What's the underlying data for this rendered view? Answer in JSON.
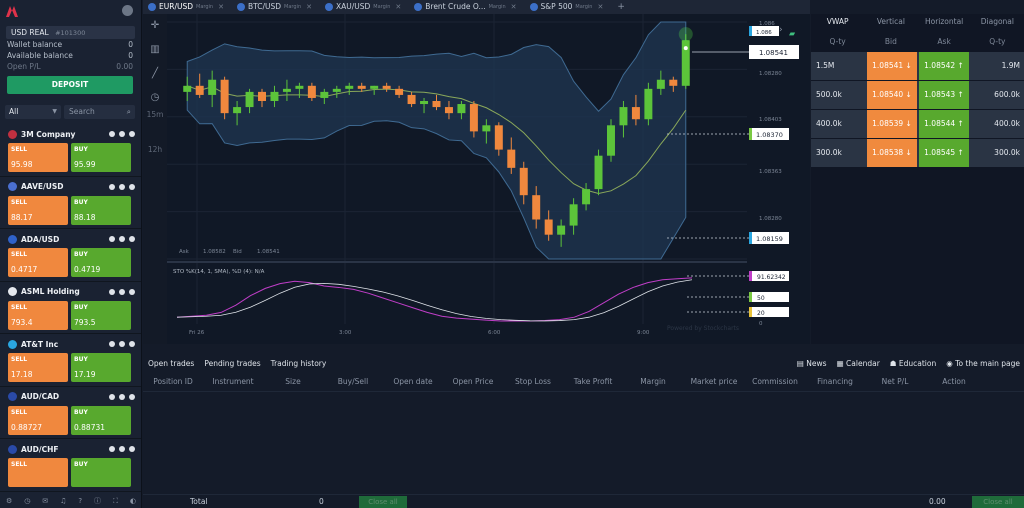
{
  "account": {
    "currency": "USD",
    "mode": "REAL",
    "id": "#101300",
    "wallet_label": "Wallet balance",
    "wallet_value": "0",
    "available_label": "Available balance",
    "available_value": "0",
    "pl_label": "Open P/L",
    "pl_value": "0.00",
    "deposit_label": "DEPOSIT"
  },
  "filter": {
    "selected": "All",
    "search_placeholder": "Search"
  },
  "instruments": [
    {
      "name": "3M Company",
      "sell_label": "SELL",
      "buy_label": "BUY",
      "sell": "95.98",
      "buy": "95.99",
      "flag_color": "#c03040"
    },
    {
      "name": "AAVE/USD",
      "sell_label": "SELL",
      "buy_label": "BUY",
      "sell": "88.17",
      "buy": "88.18",
      "flag_color": "#4a6fd0"
    },
    {
      "name": "ADA/USD",
      "sell_label": "SELL",
      "buy_label": "BUY",
      "sell": "0.4717",
      "buy": "0.4719",
      "flag_color": "#2f62c9"
    },
    {
      "name": "ASML Holding",
      "sell_label": "SELL",
      "buy_label": "BUY",
      "sell": "793.4",
      "buy": "793.5",
      "flag_color": "#e5e8ee"
    },
    {
      "name": "AT&T Inc",
      "sell_label": "SELL",
      "buy_label": "BUY",
      "sell": "17.18",
      "buy": "17.19",
      "flag_color": "#2aa6e0"
    },
    {
      "name": "AUD/CAD",
      "sell_label": "SELL",
      "buy_label": "BUY",
      "sell": "0.88727",
      "buy": "0.88731",
      "flag_color": "#2a4aa8"
    },
    {
      "name": "AUD/CHF",
      "sell_label": "SELL",
      "buy_label": "BUY",
      "sell": "",
      "buy": "",
      "flag_color": "#2a4aa8"
    }
  ],
  "tabs": [
    {
      "label": "EUR/USD",
      "tag": "Margin"
    },
    {
      "label": "BTC/USD",
      "tag": "Margin"
    },
    {
      "label": "XAU/USD",
      "tag": "Margin"
    },
    {
      "label": "Brent Crude O...",
      "tag": "Margin"
    },
    {
      "label": "S&P 500",
      "tag": "Margin"
    }
  ],
  "timeframes": [
    "15m",
    "12h"
  ],
  "chart_data": {
    "type": "candlestick",
    "price_labels": {
      "top": "1.086",
      "current": "1.08541",
      "mid1": "1.08280",
      "mid2": "1.08403",
      "level1": "1.08370",
      "mid3": "1.08363",
      "mid4": "1.08280",
      "level2": "1.08159"
    },
    "ohlc_readout": {
      "ask_label": "Ask",
      "ask": "1.08582",
      "bid_label": "Bid",
      "bid": "1.08541"
    },
    "candles": [
      [
        1.0845,
        1.085,
        1.0842,
        1.0847
      ],
      [
        1.0847,
        1.0851,
        1.0843,
        1.0844
      ],
      [
        1.0844,
        1.0852,
        1.084,
        1.0849
      ],
      [
        1.0849,
        1.085,
        1.0836,
        1.0838
      ],
      [
        1.0838,
        1.0842,
        1.0834,
        1.084
      ],
      [
        1.084,
        1.0846,
        1.0838,
        1.0845
      ],
      [
        1.0845,
        1.0846,
        1.084,
        1.0842
      ],
      [
        1.0842,
        1.0847,
        1.084,
        1.0845
      ],
      [
        1.0845,
        1.0849,
        1.0842,
        1.0846
      ],
      [
        1.0846,
        1.0848,
        1.0843,
        1.0847
      ],
      [
        1.0847,
        1.0848,
        1.0842,
        1.0843
      ],
      [
        1.0843,
        1.0846,
        1.0841,
        1.0845
      ],
      [
        1.0845,
        1.0847,
        1.0843,
        1.0846
      ],
      [
        1.0846,
        1.0848,
        1.0844,
        1.0847
      ],
      [
        1.0847,
        1.0848,
        1.0845,
        1.0846
      ],
      [
        1.0846,
        1.0847,
        1.0844,
        1.0847
      ],
      [
        1.0847,
        1.0848,
        1.0845,
        1.0846
      ],
      [
        1.0846,
        1.0847,
        1.0843,
        1.0844
      ],
      [
        1.0844,
        1.0845,
        1.084,
        1.0841
      ],
      [
        1.0841,
        1.0843,
        1.0838,
        1.0842
      ],
      [
        1.0842,
        1.0844,
        1.0839,
        1.084
      ],
      [
        1.084,
        1.0842,
        1.0836,
        1.0838
      ],
      [
        1.0838,
        1.0842,
        1.0836,
        1.0841
      ],
      [
        1.0841,
        1.0842,
        1.083,
        1.0832
      ],
      [
        1.0832,
        1.0836,
        1.0828,
        1.0834
      ],
      [
        1.0834,
        1.0835,
        1.0824,
        1.0826
      ],
      [
        1.0826,
        1.083,
        1.0818,
        1.082
      ],
      [
        1.082,
        1.0822,
        1.0808,
        1.0811
      ],
      [
        1.0811,
        1.0814,
        1.08,
        1.0803
      ],
      [
        1.0803,
        1.0806,
        1.0796,
        1.0798
      ],
      [
        1.0798,
        1.0803,
        1.0794,
        1.0801
      ],
      [
        1.0801,
        1.081,
        1.0798,
        1.0808
      ],
      [
        1.0808,
        1.0815,
        1.0806,
        1.0813
      ],
      [
        1.0813,
        1.0826,
        1.0811,
        1.0824
      ],
      [
        1.0824,
        1.0836,
        1.0822,
        1.0834
      ],
      [
        1.0834,
        1.0842,
        1.083,
        1.084
      ],
      [
        1.084,
        1.0844,
        1.0834,
        1.0836
      ],
      [
        1.0836,
        1.0848,
        1.0834,
        1.0846
      ],
      [
        1.0846,
        1.0852,
        1.0844,
        1.0849
      ],
      [
        1.0849,
        1.085,
        1.0845,
        1.0847
      ],
      [
        1.0847,
        1.0864,
        1.0846,
        1.0862
      ]
    ],
    "x_ticks": [
      "Fri 26",
      "3:00",
      "6:00",
      "9:00"
    ],
    "indicator_label": "STO %K(14, 1, SMA), %D (4): N/A",
    "indicator_levels": [
      "91.62342",
      "50",
      "20",
      "0"
    ],
    "watermark": "Powered by Stockcharts"
  },
  "depth": {
    "tabs": [
      "VWAP",
      "Vertical",
      "Horizontal",
      "Diagonal"
    ],
    "headers": [
      "Q-ty",
      "Bid",
      "Ask",
      "Q-ty"
    ],
    "rows": [
      {
        "qty_left": "1.5M",
        "bid": "1.08541",
        "ask": "1.08542",
        "qty_right": "1.9M"
      },
      {
        "qty_left": "500.0k",
        "bid": "1.08540",
        "ask": "1.08543",
        "qty_right": "600.0k"
      },
      {
        "qty_left": "400.0k",
        "bid": "1.08539",
        "ask": "1.08544",
        "qty_right": "400.0k"
      },
      {
        "qty_left": "300.0k",
        "bid": "1.08538",
        "ask": "1.08545",
        "qty_right": "300.0k"
      }
    ]
  },
  "bottom": {
    "tabs": [
      "Open trades",
      "Pending trades",
      "Trading history"
    ],
    "links": [
      "News",
      "Calendar",
      "Education",
      "To the main page"
    ],
    "columns": [
      "Position ID",
      "Instrument",
      "Size",
      "Buy/Sell",
      "Open date",
      "Open Price",
      "Stop Loss",
      "Take Profit",
      "Margin",
      "Market price",
      "Commission",
      "Financing",
      "Net P/L",
      "Action"
    ],
    "total_label": "Total",
    "total_value": "0",
    "close_all_label": "Close all",
    "net_total": "0.00",
    "close_all2_label": "Close all"
  }
}
